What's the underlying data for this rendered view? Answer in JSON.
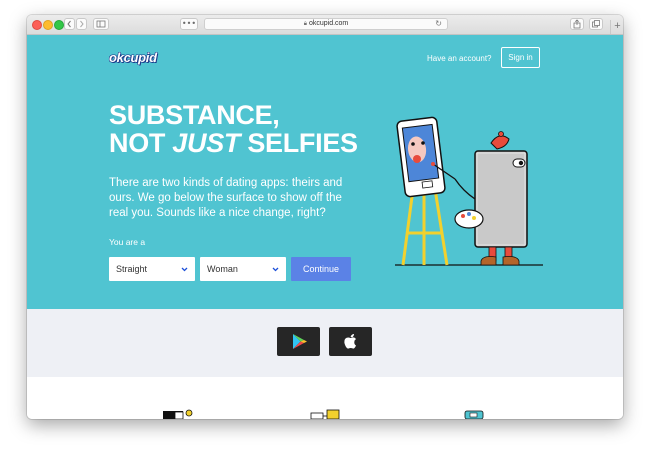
{
  "browser": {
    "url": "okcupid.com",
    "tab_overview_glyph": "•••",
    "new_tab_glyph": "+"
  },
  "icons": [
    "back-icon",
    "forward-icon",
    "sidebar-icon",
    "lock-icon",
    "reload-icon",
    "share-icon",
    "tabs-icon",
    "google-play-icon",
    "apple-icon"
  ],
  "header": {
    "logo": "okcupid",
    "have_account": "Have an account?",
    "signin": "Sign in"
  },
  "hero": {
    "headline_line1": "SUBSTANCE,",
    "headline_not": "NOT ",
    "headline_just": "JUST",
    "headline_selfies": " SELFIES",
    "subtext": "There are two kinds of dating apps: theirs and ours. We go below the surface to show off the real you. Sounds like a nice change, right?",
    "you_are_label": "You are a",
    "orientation_value": "Straight",
    "gender_value": "Woman",
    "continue_label": "Continue"
  },
  "colors": {
    "hero_bg": "#50c4d1",
    "continue_bg": "#5b82e6",
    "app_strip_bg": "#eef0f5"
  }
}
